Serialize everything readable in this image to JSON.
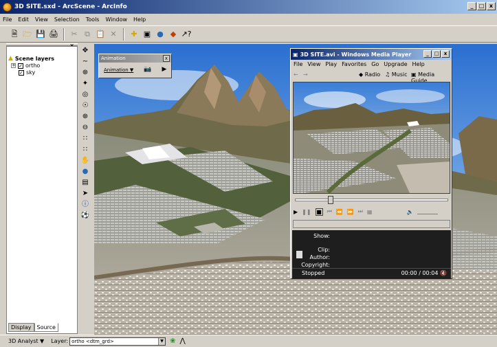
{
  "window": {
    "title": "3D SITE.sxd - ArcScene - ArcInfo",
    "controls": [
      "_",
      "ł",
      "x"
    ]
  },
  "menubar": [
    "File",
    "Edit",
    "View",
    "Selection",
    "Tools",
    "Window",
    "Help"
  ],
  "toc": {
    "title": "Scene layers",
    "layers": [
      {
        "name": "ortho",
        "checked": true,
        "expandable": true
      },
      {
        "name": "sky",
        "checked": true,
        "expandable": false
      }
    ],
    "tabs": [
      "Display",
      "Source"
    ]
  },
  "animation": {
    "title": "Animation",
    "menu": "Animation ▼"
  },
  "wmp": {
    "title": "3D SITE.avi - Windows Media Player",
    "menus": [
      "File",
      "View",
      "Play",
      "Favorites",
      "Go",
      "Upgrade",
      "Help"
    ],
    "nav": {
      "radio": "Radio",
      "music": "Music",
      "guide": "Media Guide"
    },
    "seek_fraction": 0.22,
    "info": {
      "show": "Show:",
      "clip": "Clip:",
      "author": "Author:",
      "copyright": "Copyright:"
    },
    "status": "Stopped",
    "time": "00:00 / 00:04"
  },
  "statusbar": {
    "analyst": "3D Analyst ▼",
    "layer_label": "Layer:",
    "layer_value": "ortho <dtm_grd>"
  }
}
